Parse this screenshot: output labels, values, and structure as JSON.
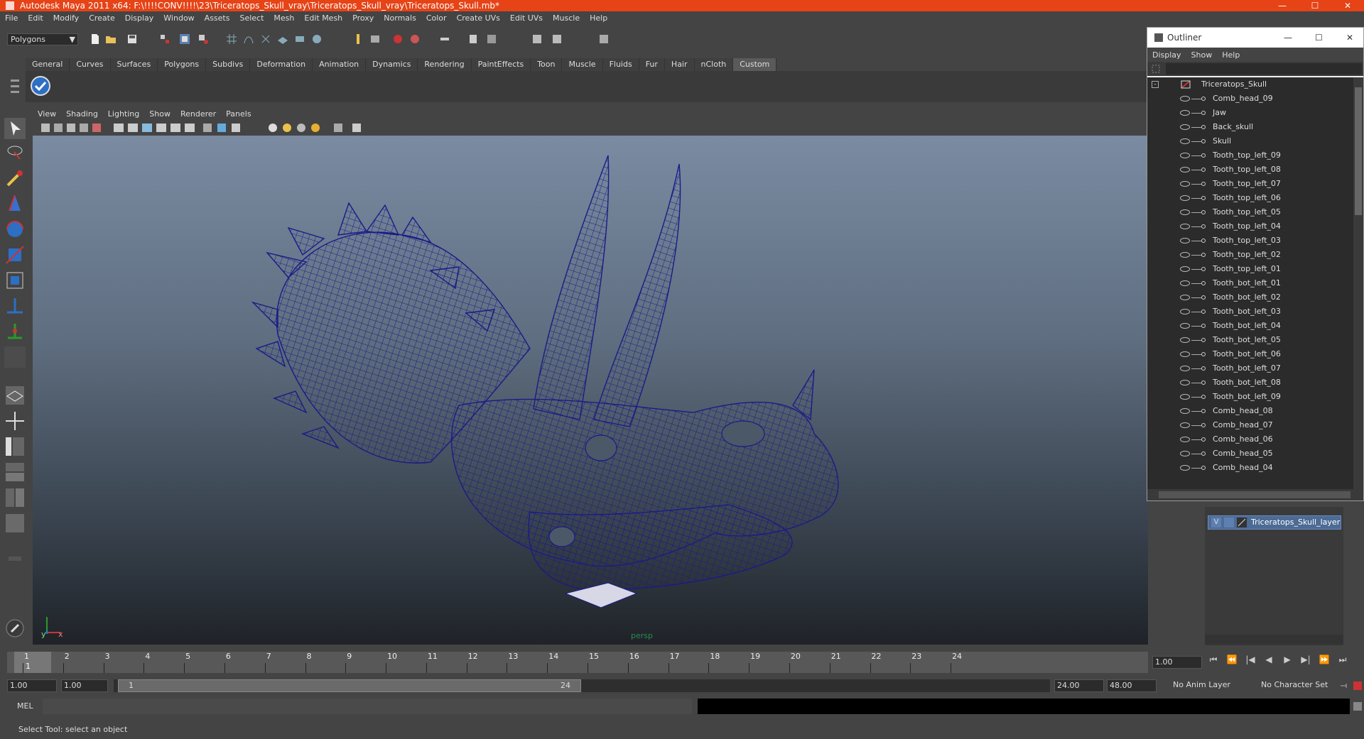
{
  "window": {
    "title": "Autodesk Maya 2011 x64: F:\\!!!!CONV!!!!\\23\\Triceratops_Skull_vray\\Triceratops_Skull_vray\\Triceratops_Skull.mb*",
    "minimize": "—",
    "maximize": "☐",
    "close": "✕"
  },
  "menubar": [
    "File",
    "Edit",
    "Modify",
    "Create",
    "Display",
    "Window",
    "Assets",
    "Select",
    "Mesh",
    "Edit Mesh",
    "Proxy",
    "Normals",
    "Color",
    "Create UVs",
    "Edit UVs",
    "Muscle",
    "Help"
  ],
  "mode_selector": {
    "value": "Polygons",
    "arrow": "▼"
  },
  "shelf_tabs": [
    "General",
    "Curves",
    "Surfaces",
    "Polygons",
    "Subdivs",
    "Deformation",
    "Animation",
    "Dynamics",
    "Rendering",
    "PaintEffects",
    "Toon",
    "Muscle",
    "Fluids",
    "Fur",
    "Hair",
    "nCloth",
    "Custom"
  ],
  "shelf_active": "Custom",
  "panel_menu": [
    "View",
    "Shading",
    "Lighting",
    "Show",
    "Renderer",
    "Panels"
  ],
  "viewport": {
    "camera_label": "persp",
    "axis_y": "y",
    "axis_x": "x",
    "wire_color": "#1b1b86"
  },
  "timeline": {
    "ticks": [
      "1",
      "2",
      "3",
      "4",
      "5",
      "6",
      "7",
      "8",
      "9",
      "10",
      "11",
      "12",
      "13",
      "14",
      "15",
      "16",
      "17",
      "18",
      "19",
      "20",
      "21",
      "22",
      "23",
      "24"
    ],
    "current_frame": "1",
    "current_value": "1.00"
  },
  "playback_buttons": [
    "⏮",
    "⏪",
    "|◀",
    "◀",
    "▶",
    "▶|",
    "⏩",
    "⏭"
  ],
  "range": {
    "start": "1.00",
    "playback_start": "1.00",
    "slider_start": "1",
    "slider_end": "24",
    "playback_end": "24.00",
    "end": "48.00",
    "anim_layer": "No Anim Layer",
    "character_set": "No Character Set"
  },
  "mel_label": "MEL",
  "status_text": "Select Tool: select an object",
  "outliner": {
    "title": "Outliner",
    "menu": [
      "Display",
      "Show",
      "Help"
    ],
    "root": "Triceratops_Skull",
    "items": [
      "Comb_head_09",
      "Jaw",
      "Back_skull",
      "Skull",
      "Tooth_top_left_09",
      "Tooth_top_left_08",
      "Tooth_top_left_07",
      "Tooth_top_left_06",
      "Tooth_top_left_05",
      "Tooth_top_left_04",
      "Tooth_top_left_03",
      "Tooth_top_left_02",
      "Tooth_top_left_01",
      "Tooth_bot_left_01",
      "Tooth_bot_left_02",
      "Tooth_bot_left_03",
      "Tooth_bot_left_04",
      "Tooth_bot_left_05",
      "Tooth_bot_left_06",
      "Tooth_bot_left_07",
      "Tooth_bot_left_08",
      "Tooth_bot_left_09",
      "Comb_head_08",
      "Comb_head_07",
      "Comb_head_06",
      "Comb_head_05",
      "Comb_head_04"
    ]
  },
  "layer": {
    "visible": "V",
    "name": "Triceratops_Skull_layer"
  }
}
